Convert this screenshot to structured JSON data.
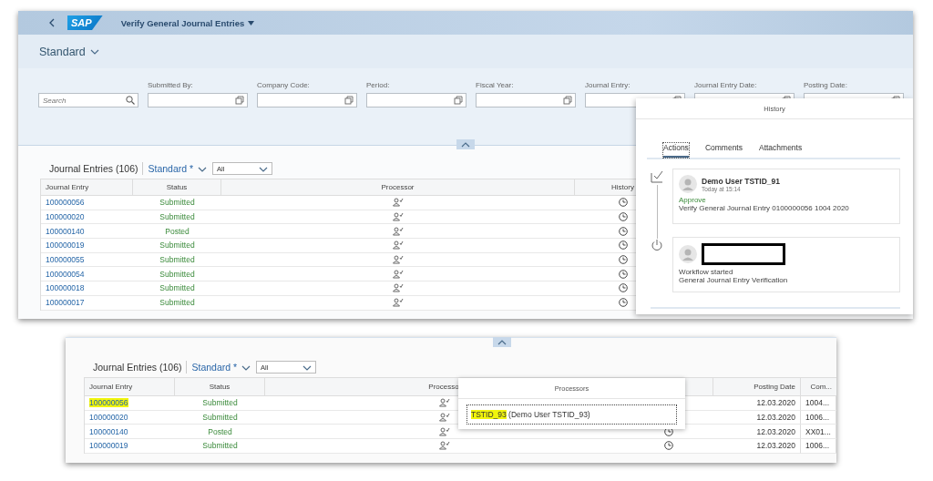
{
  "app_header": {
    "logo": "SAP",
    "title": "Verify General Journal Entries"
  },
  "variant": {
    "label": "Standard"
  },
  "filter_bar": {
    "search": {
      "placeholder": "Search"
    },
    "fields": [
      {
        "label": "Submitted By:"
      },
      {
        "label": "Company Code:"
      },
      {
        "label": "Period:"
      },
      {
        "label": "Fiscal Year:"
      },
      {
        "label": "Journal Entry:"
      },
      {
        "label": "Journal Entry Date:"
      },
      {
        "label": "Posting Date:"
      }
    ]
  },
  "top_table": {
    "title": "Journal Entries (106)",
    "variant": "Standard *",
    "filter": {
      "value": "All"
    },
    "columns": [
      "Journal Entry",
      "Status",
      "Processor",
      "History"
    ],
    "rows": [
      {
        "entry": "100000056",
        "status": "Submitted"
      },
      {
        "entry": "100000020",
        "status": "Submitted"
      },
      {
        "entry": "100000140",
        "status": "Posted"
      },
      {
        "entry": "100000019",
        "status": "Submitted"
      },
      {
        "entry": "100000055",
        "status": "Submitted"
      },
      {
        "entry": "100000054",
        "status": "Submitted"
      },
      {
        "entry": "100000018",
        "status": "Submitted"
      },
      {
        "entry": "100000017",
        "status": "Submitted"
      }
    ]
  },
  "history_popover": {
    "title": "History",
    "tabs": [
      {
        "label": "Actions",
        "selected": true
      },
      {
        "label": "Comments",
        "selected": false
      },
      {
        "label": "Attachments",
        "selected": false
      }
    ],
    "entries": [
      {
        "kind": "approve",
        "user": "Demo User TSTID_91",
        "time": "Today at 15:14",
        "action": "Approve",
        "description": "Verify General Journal Entry 0100000056 1004 2020",
        "redacted": false
      },
      {
        "kind": "start",
        "action": "Workflow started",
        "description": "General Journal Entry Verification",
        "redacted": true
      }
    ]
  },
  "bottom_table": {
    "title": "Journal Entries (106)",
    "variant": "Standard *",
    "filter": {
      "value": "All"
    },
    "columns": [
      "Journal Entry",
      "Status",
      "Processo",
      "Posting Date",
      "Com..."
    ],
    "rows": [
      {
        "entry": "100000056",
        "highlighted": true,
        "status": "Submitted",
        "posting_date": "12.03.2020",
        "company": "1004..."
      },
      {
        "entry": "100000020",
        "highlighted": false,
        "status": "Submitted",
        "posting_date": "12.03.2020",
        "company": "1006..."
      },
      {
        "entry": "100000140",
        "highlighted": false,
        "status": "Posted",
        "history_icon": true,
        "posting_date": "12.03.2020",
        "company": "XX01..."
      },
      {
        "entry": "100000019",
        "highlighted": false,
        "status": "Submitted",
        "history_icon": true,
        "posting_date": "12.03.2020",
        "company": "1006..."
      }
    ]
  },
  "processors_popover": {
    "title": "Processors",
    "items": [
      {
        "id": "TSTID_93",
        "name": "(Demo User TSTID_93)",
        "highlighted": true
      }
    ]
  }
}
